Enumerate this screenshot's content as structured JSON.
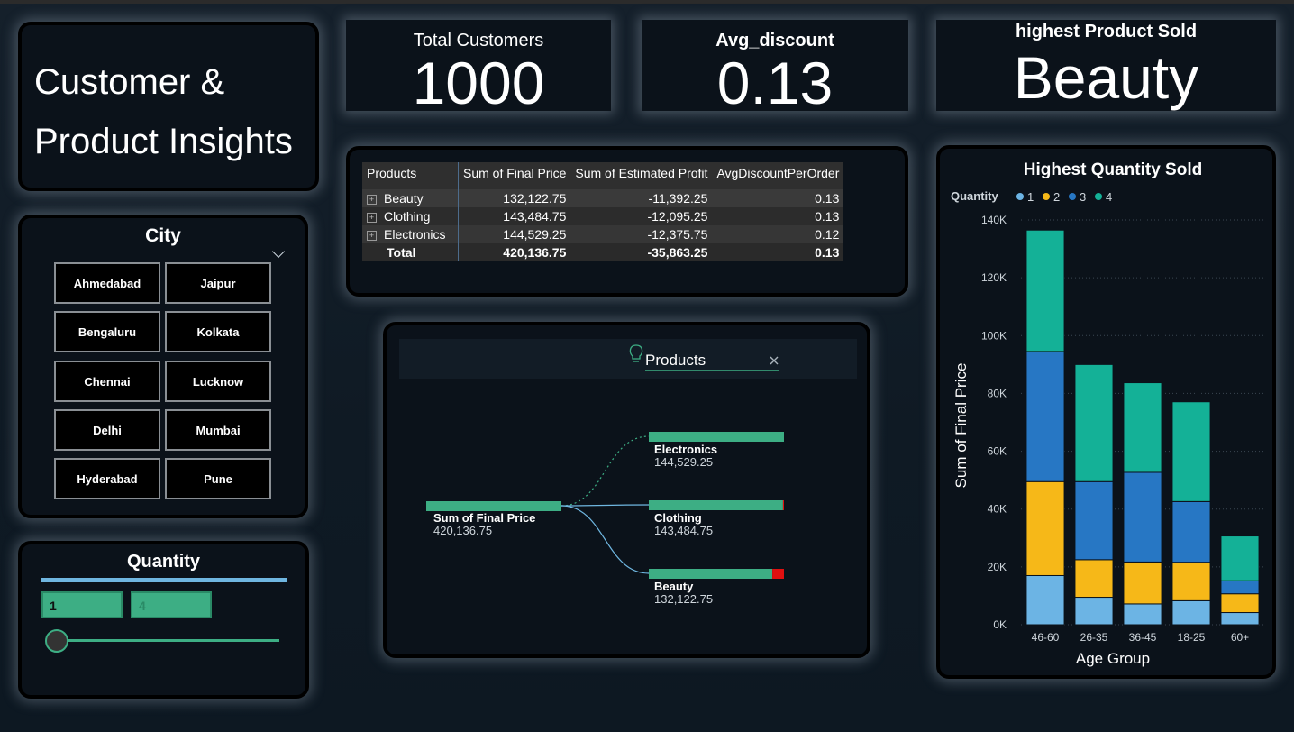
{
  "kpis": [
    {
      "label": "Total Customers",
      "value": "1000"
    },
    {
      "label": "Avg_discount",
      "value": "0.13"
    },
    {
      "label": "highest Product Sold",
      "value": "Beauty"
    }
  ],
  "title": {
    "line1": "Customer &",
    "line2": "Product Insights"
  },
  "city_slicer": {
    "title": "City",
    "cities": [
      "Ahmedabad",
      "Jaipur",
      "Bengaluru",
      "Kolkata",
      "Chennai",
      "Lucknow",
      "Delhi",
      "Mumbai",
      "Hyderabad",
      "Pune"
    ]
  },
  "quantity_slicer": {
    "title": "Quantity",
    "min": "1",
    "max": "4"
  },
  "table": {
    "headers": [
      "Products",
      "Sum of Final Price",
      "Sum of Estimated Profit",
      "AvgDiscountPerOrder"
    ],
    "rows": [
      [
        "Beauty",
        "132,122.75",
        "-11,392.25",
        "0.13"
      ],
      [
        "Clothing",
        "143,484.75",
        "-12,095.25",
        "0.13"
      ],
      [
        "Electronics",
        "144,529.25",
        "-12,375.75",
        "0.12"
      ]
    ],
    "total": [
      "Total",
      "420,136.75",
      "-35,863.25",
      "0.13"
    ]
  },
  "tree": {
    "header": "Products",
    "root": {
      "label": "Sum of Final Price",
      "value": "420,136.75"
    },
    "nodes": [
      {
        "label": "Electronics",
        "value": "144,529.25",
        "v": 144529.25
      },
      {
        "label": "Clothing",
        "value": "143,484.75",
        "v": 143484.75
      },
      {
        "label": "Beauty",
        "value": "132,122.75",
        "v": 132122.75
      }
    ],
    "colors": {
      "bar": "#3dae84",
      "neg": "#e01010",
      "link": "#6fb6e0"
    }
  },
  "chart_data": {
    "type": "bar",
    "stacked": true,
    "title": "Highest Quantity Sold",
    "xlabel": "Age Group",
    "ylabel": "Sum of Final Price",
    "legend_title": "Quantity",
    "legend_position": "top-left",
    "categories": [
      "46-60",
      "26-35",
      "36-45",
      "18-25",
      "60+"
    ],
    "series": [
      {
        "name": "1",
        "color": "#6cb4e4",
        "values": [
          17000,
          9500,
          7200,
          8300,
          4200
        ]
      },
      {
        "name": "2",
        "color": "#f6b818",
        "values": [
          32500,
          13000,
          14500,
          13300,
          6500
        ]
      },
      {
        "name": "3",
        "color": "#2777c4",
        "values": [
          45000,
          27000,
          31000,
          21000,
          4500
        ]
      },
      {
        "name": "4",
        "color": "#14b197",
        "values": [
          42000,
          40500,
          31000,
          34500,
          15500
        ]
      }
    ],
    "ylim": [
      0,
      140000
    ],
    "yticks": [
      "0K",
      "20K",
      "40K",
      "60K",
      "80K",
      "100K",
      "120K",
      "140K"
    ],
    "grid": true
  }
}
